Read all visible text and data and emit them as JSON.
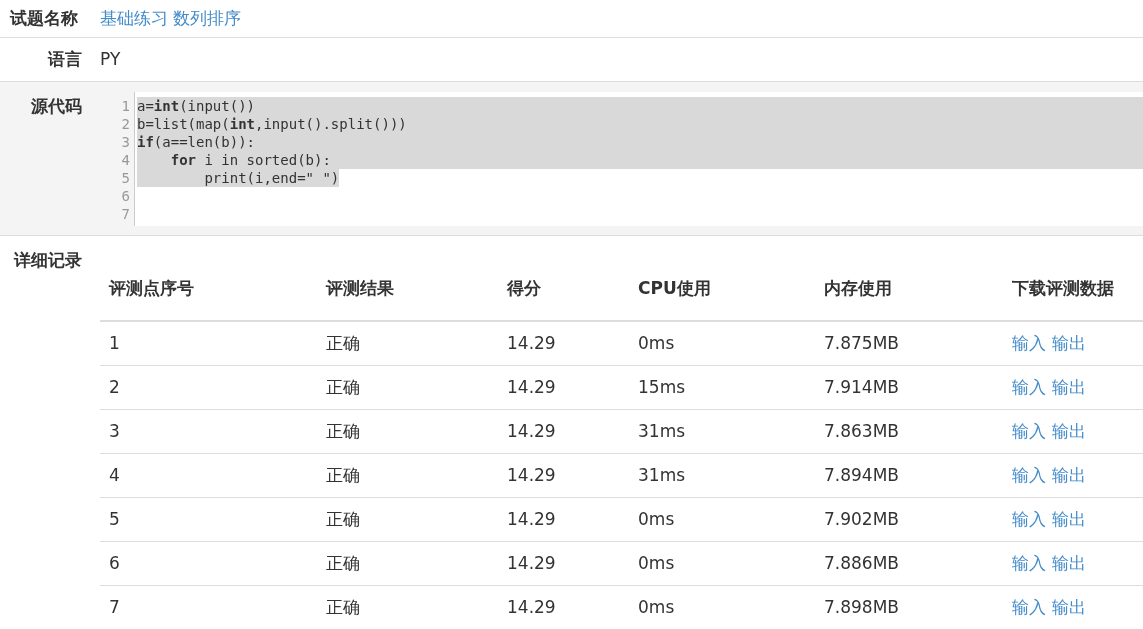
{
  "problem": {
    "label": "试题名称",
    "title": "基础练习 数列排序"
  },
  "language": {
    "label": "语言",
    "value": "PY"
  },
  "source": {
    "label": "源代码",
    "lines": [
      {
        "number": "1",
        "code": "a=**int**(input())",
        "selected": true
      },
      {
        "number": "2",
        "code": "b=list(map(**int**,input().split()))",
        "selected": true
      },
      {
        "number": "3",
        "code": "**if**(a==len(b)):",
        "selected": true
      },
      {
        "number": "4",
        "code": "    **for** i in sorted(b):",
        "selected": true
      },
      {
        "number": "5",
        "code": "        print(i,end=\" \")",
        "selected": true
      },
      {
        "number": "6"
      },
      {
        "number": "7"
      }
    ]
  },
  "details": {
    "label": "详细记录",
    "columns": [
      "评测点序号",
      "评测结果",
      "得分",
      "CPU使用",
      "内存使用",
      "下载评测数据"
    ],
    "rows": [
      {
        "index": "1",
        "result": "正确",
        "score": "14.29",
        "cpu": "0ms",
        "memory": "7.875MB",
        "links": [
          "输入",
          "输出"
        ]
      },
      {
        "index": "2",
        "result": "正确",
        "score": "14.29",
        "cpu": "15ms",
        "memory": "7.914MB",
        "links": [
          "输入",
          "输出"
        ]
      },
      {
        "index": "3",
        "result": "正确",
        "score": "14.29",
        "cpu": "31ms",
        "memory": "7.863MB",
        "links": [
          "输入",
          "输出"
        ]
      },
      {
        "index": "4",
        "result": "正确",
        "score": "14.29",
        "cpu": "31ms",
        "memory": "7.894MB",
        "links": [
          "输入",
          "输出"
        ]
      },
      {
        "index": "5",
        "result": "正确",
        "score": "14.29",
        "cpu": "0ms",
        "memory": "7.902MB",
        "links": [
          "输入",
          "输出"
        ]
      },
      {
        "index": "6",
        "result": "正确",
        "score": "14.29",
        "cpu": "0ms",
        "memory": "7.886MB",
        "links": [
          "输入",
          "输出"
        ]
      },
      {
        "index": "7",
        "result": "正确",
        "score": "14.29",
        "cpu": "0ms",
        "memory": "7.898MB",
        "links": [
          "输入",
          "输出"
        ]
      }
    ]
  }
}
